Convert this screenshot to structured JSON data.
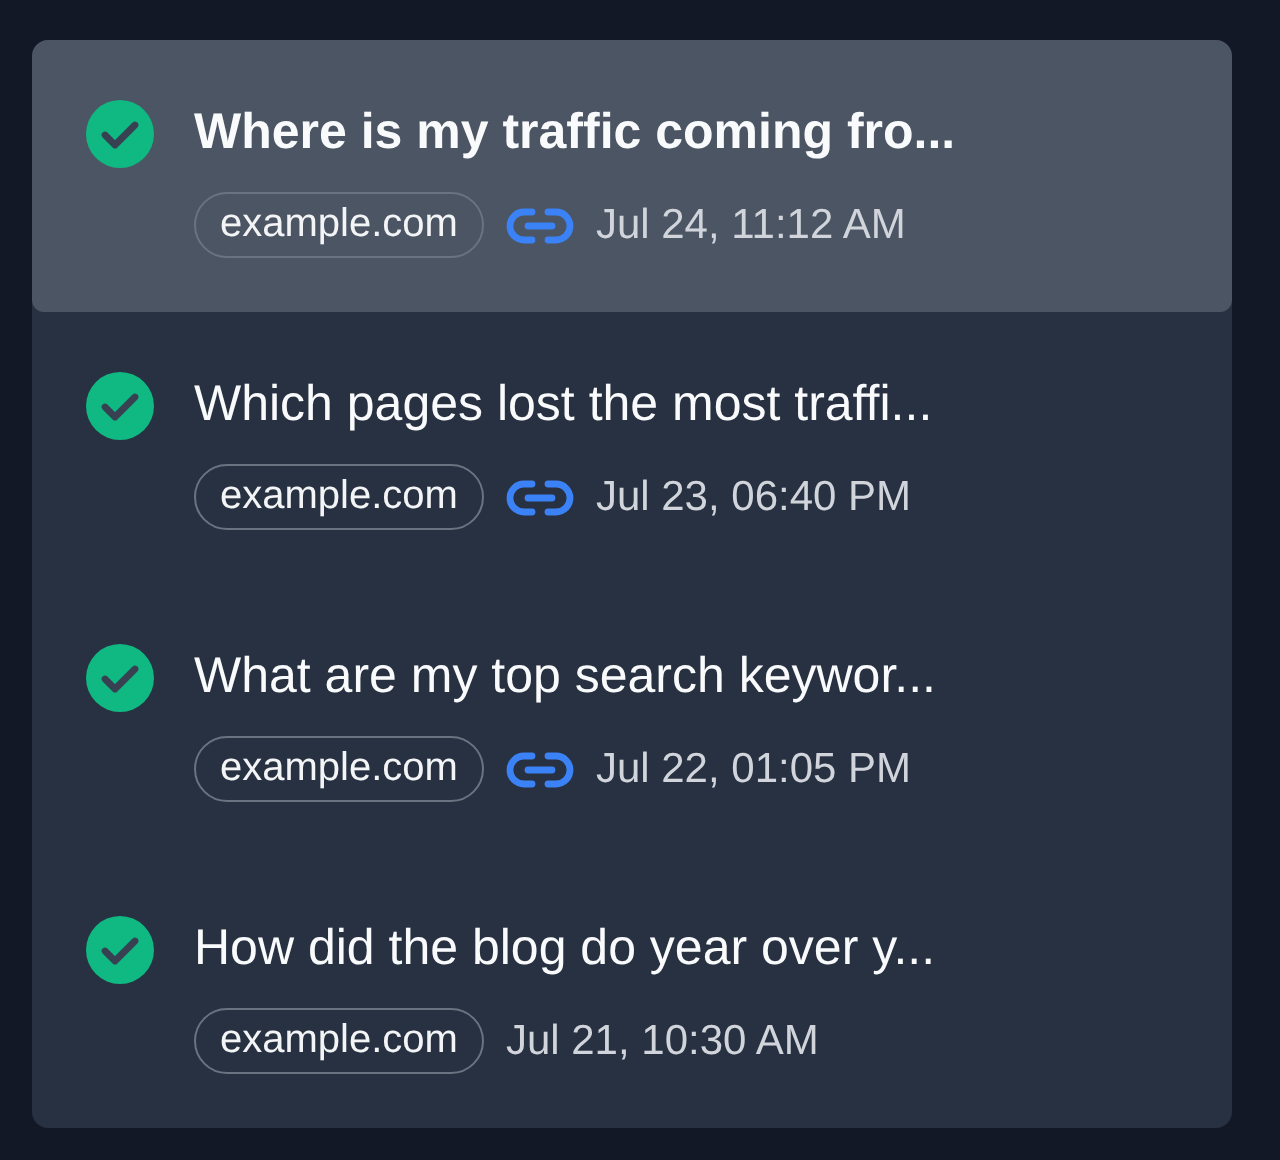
{
  "conversations": [
    {
      "title": "Where is my traffic coming fro...",
      "done": true,
      "site": "example.com",
      "linked": true,
      "time": "Jul 24, 11:12 AM",
      "selected": true
    },
    {
      "title": "Which pages lost the most traffi...",
      "done": true,
      "site": "example.com",
      "linked": true,
      "time": "Jul 23, 06:40 PM",
      "selected": false
    },
    {
      "title": "What are my top search keywor...",
      "done": true,
      "site": "example.com",
      "linked": true,
      "time": "Jul 22, 01:05 PM",
      "selected": false
    },
    {
      "title": "How did the blog do year over y...",
      "done": true,
      "site": "example.com",
      "linked": false,
      "time": "Jul 21, 10:30 AM",
      "selected": false
    }
  ]
}
